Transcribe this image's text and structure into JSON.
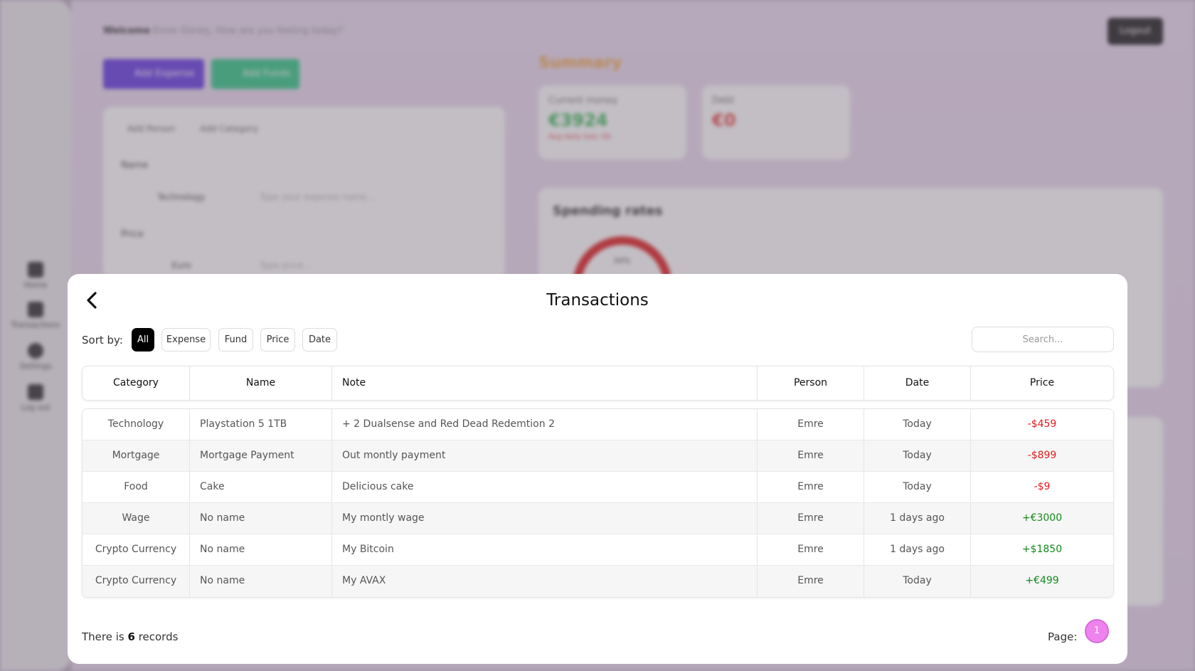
{
  "background": {
    "welcome_bold": "Welcome",
    "welcome_rest": " Emre Güney, How are you feeling today?",
    "logout": "Logout",
    "add_expense": "Add Expense",
    "add_funds": "Add Funds",
    "form_tabs": [
      "Add Person",
      "Add Category"
    ],
    "form_name_label": "Name",
    "form_name_pill": "Technology",
    "form_name_placeholder": "Type your expense name...",
    "form_price_label": "Price",
    "form_price_pill": "Euro",
    "form_price_placeholder": "Type price...",
    "summary_title": "Summary",
    "current_money_label": "Current money",
    "current_money_value": "€3924",
    "current_money_sub": "Avg daily loss: €8",
    "debt_label": "Debt",
    "debt_value": "€0",
    "spending_rates_title": "Spending rates",
    "gauge_value": "34%",
    "sidebar": [
      "Home",
      "Transactions",
      "Settings",
      "Log out"
    ]
  },
  "modal": {
    "title": "Transactions",
    "sort_label": "Sort by:",
    "sort_options": [
      "All",
      "Expense",
      "Fund",
      "Price",
      "Date"
    ],
    "active_sort": "All",
    "search_placeholder": "Search...",
    "columns": [
      "Category",
      "Name",
      "Note",
      "Person",
      "Date",
      "Price"
    ],
    "rows": [
      {
        "category": "Technology",
        "name": "Playstation 5 1TB",
        "note": "+ 2 Dualsense and Red Dead Redemtion 2",
        "person": "Emre",
        "date": "Today",
        "price": "-$459"
      },
      {
        "category": "Mortgage",
        "name": "Mortgage Payment",
        "note": "Out montly payment",
        "person": "Emre",
        "date": "Today",
        "price": "-$899"
      },
      {
        "category": "Food",
        "name": "Cake",
        "note": "Delicious cake",
        "person": "Emre",
        "date": "Today",
        "price": "-$9"
      },
      {
        "category": "Wage",
        "name": "No name",
        "note": "My montly wage",
        "person": "Emre",
        "date": "1 days ago",
        "price": "+€3000"
      },
      {
        "category": "Crypto Currency",
        "name": "No name",
        "note": "My Bitcoin",
        "person": "Emre",
        "date": "1 days ago",
        "price": "+$1850"
      },
      {
        "category": "Crypto Currency",
        "name": "No name",
        "note": "My AVAX",
        "person": "Emre",
        "date": "Today",
        "price": "+€499"
      }
    ],
    "records_prefix": "There is ",
    "records_count": "6",
    "records_suffix": " records",
    "page_label": "Page:",
    "current_page": "1"
  },
  "colors": {
    "negative": "#e01b1b",
    "positive": "#128a1a",
    "page_active": "#ee82ee"
  }
}
